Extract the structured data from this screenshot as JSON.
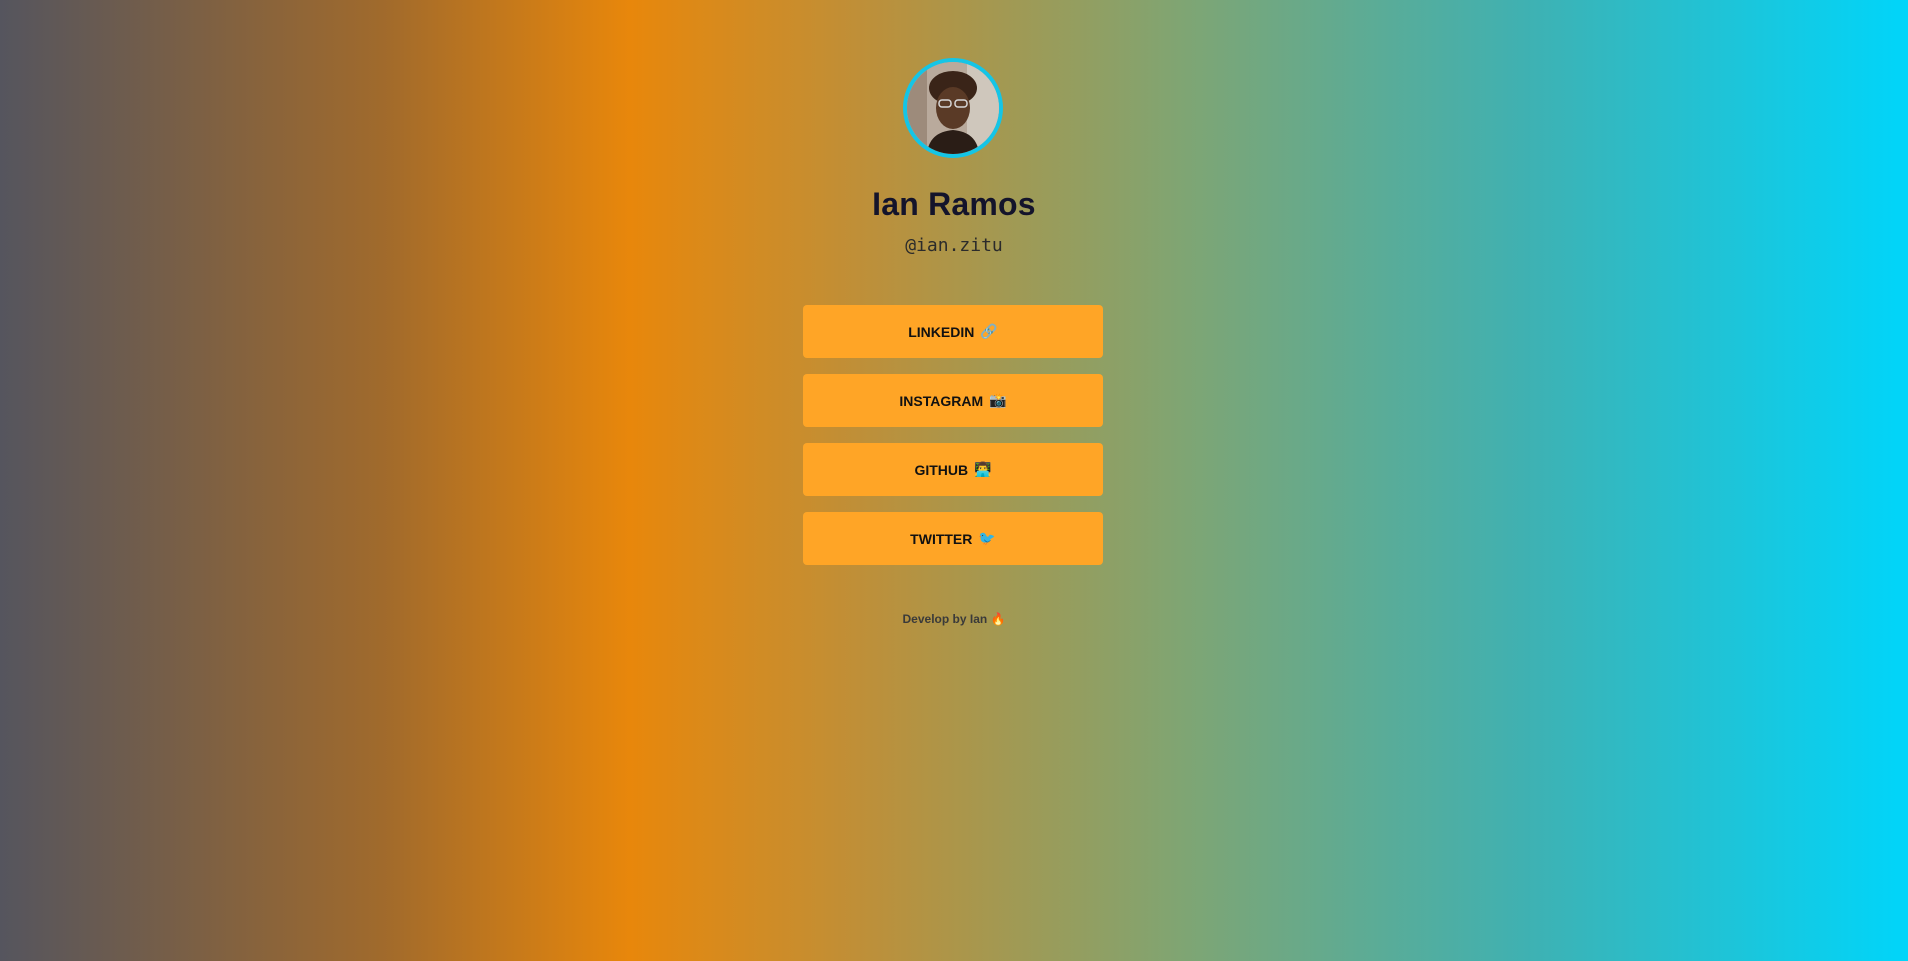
{
  "profile": {
    "name": "Ian Ramos",
    "handle": "@ian.zitu",
    "avatar_icon": "avatar-photo"
  },
  "links": [
    {
      "label": "LINKEDIN",
      "emoji": "🔗",
      "icon": "link-icon"
    },
    {
      "label": "INSTAGRAM",
      "emoji": "📸",
      "icon": "camera-icon"
    },
    {
      "label": "GITHUB",
      "emoji": "👨‍💻",
      "icon": "technologist-icon"
    },
    {
      "label": "TWITTER",
      "emoji": "🐦",
      "icon": "bird-icon"
    }
  ],
  "footer": {
    "text": "Develop by Ian",
    "emoji": "🔥"
  },
  "colors": {
    "button_bg": "#ffa526",
    "avatar_ring": "#15c5e6",
    "name_text": "#14142b"
  }
}
